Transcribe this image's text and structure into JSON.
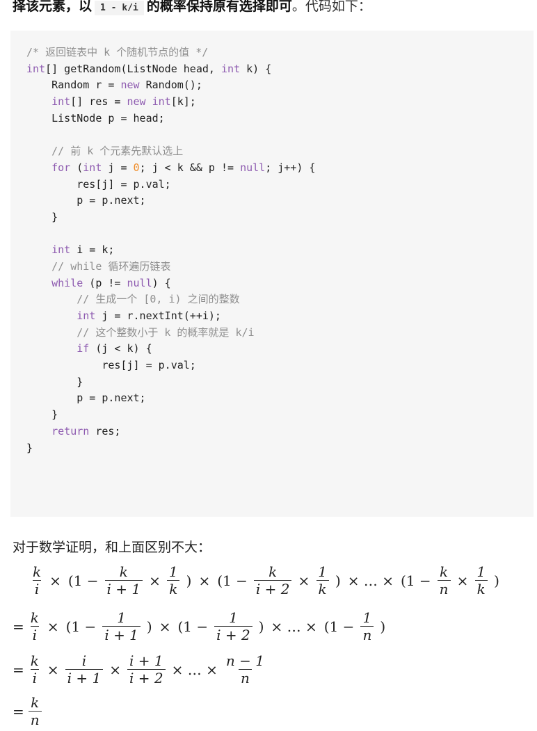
{
  "intro_line": {
    "bold_prefix": "择该元素，以",
    "inline_code": "1 - k/i",
    "bold_suffix": "的概率保持原有选择即可",
    "tail": "。代码如下："
  },
  "code": {
    "language": "java",
    "lines": [
      [
        {
          "t": "/* 返回链表中 k 个随机节点的值 */",
          "c": "cm"
        }
      ],
      [
        {
          "t": "int",
          "c": "kw"
        },
        {
          "t": "[] getRandom(ListNode head, "
        },
        {
          "t": "int",
          "c": "kw"
        },
        {
          "t": " k) {"
        }
      ],
      [
        {
          "t": "    Random r = "
        },
        {
          "t": "new",
          "c": "kw"
        },
        {
          "t": " Random();"
        }
      ],
      [
        {
          "t": "    "
        },
        {
          "t": "int",
          "c": "kw"
        },
        {
          "t": "[] res = "
        },
        {
          "t": "new",
          "c": "kw"
        },
        {
          "t": " "
        },
        {
          "t": "int",
          "c": "kw"
        },
        {
          "t": "[k];"
        }
      ],
      [
        {
          "t": "    ListNode p = head;"
        }
      ],
      [
        {
          "t": ""
        }
      ],
      [
        {
          "t": "    "
        },
        {
          "t": "// 前 k 个元素先默认选上",
          "c": "cm"
        }
      ],
      [
        {
          "t": "    "
        },
        {
          "t": "for",
          "c": "kw"
        },
        {
          "t": " ("
        },
        {
          "t": "int",
          "c": "kw"
        },
        {
          "t": " j = "
        },
        {
          "t": "0",
          "c": "num"
        },
        {
          "t": "; j < k && p != "
        },
        {
          "t": "null",
          "c": "kw"
        },
        {
          "t": "; j++) {"
        }
      ],
      [
        {
          "t": "        res[j] = p.val;"
        }
      ],
      [
        {
          "t": "        p = p.next;"
        }
      ],
      [
        {
          "t": "    }"
        }
      ],
      [
        {
          "t": ""
        }
      ],
      [
        {
          "t": "    "
        },
        {
          "t": "int",
          "c": "kw"
        },
        {
          "t": " i = k;"
        }
      ],
      [
        {
          "t": "    "
        },
        {
          "t": "// while 循环遍历链表",
          "c": "cm"
        }
      ],
      [
        {
          "t": "    "
        },
        {
          "t": "while",
          "c": "kw"
        },
        {
          "t": " (p != "
        },
        {
          "t": "null",
          "c": "kw"
        },
        {
          "t": ") {"
        }
      ],
      [
        {
          "t": "        "
        },
        {
          "t": "// 生成一个 [0, i) 之间的整数",
          "c": "cm"
        }
      ],
      [
        {
          "t": "        "
        },
        {
          "t": "int",
          "c": "kw"
        },
        {
          "t": " j = r.nextInt(++i);"
        }
      ],
      [
        {
          "t": "        "
        },
        {
          "t": "// 这个整数小于 k 的概率就是 k/i",
          "c": "cm"
        }
      ],
      [
        {
          "t": "        "
        },
        {
          "t": "if",
          "c": "kw"
        },
        {
          "t": " (j < k) {"
        }
      ],
      [
        {
          "t": "            res[j] = p.val;"
        }
      ],
      [
        {
          "t": "        }"
        }
      ],
      [
        {
          "t": "        p = p.next;"
        }
      ],
      [
        {
          "t": "    }"
        }
      ],
      [
        {
          "t": "    "
        },
        {
          "t": "return",
          "c": "kw"
        },
        {
          "t": " res;"
        }
      ],
      [
        {
          "t": "}"
        }
      ]
    ]
  },
  "proof_intro": "对于数学证明，和上面区别不大：",
  "math": {
    "rows": [
      [
        {
          "frac": [
            "k",
            "i"
          ]
        },
        {
          "sym": "×"
        },
        {
          "sym": "(1 −"
        },
        {
          "frac": [
            "k",
            "i + 1"
          ]
        },
        {
          "sym": "×"
        },
        {
          "frac": [
            "1",
            "k"
          ]
        },
        {
          "sym": ")"
        },
        {
          "sym": "×"
        },
        {
          "sym": "(1 −"
        },
        {
          "frac": [
            "k",
            "i + 2"
          ]
        },
        {
          "sym": "×"
        },
        {
          "frac": [
            "1",
            "k"
          ]
        },
        {
          "sym": ")"
        },
        {
          "sym": "× … ×"
        },
        {
          "sym": "(1 −"
        },
        {
          "frac": [
            "k",
            "n"
          ]
        },
        {
          "sym": "×"
        },
        {
          "frac": [
            "1",
            "k"
          ]
        },
        {
          "sym": ")"
        }
      ],
      [
        {
          "eq": "="
        },
        {
          "frac": [
            "k",
            "i"
          ]
        },
        {
          "sym": "×"
        },
        {
          "sym": "(1 −"
        },
        {
          "frac": [
            "1",
            "i + 1"
          ]
        },
        {
          "sym": ")"
        },
        {
          "sym": "×"
        },
        {
          "sym": "(1 −"
        },
        {
          "frac": [
            "1",
            "i + 2"
          ]
        },
        {
          "sym": ")"
        },
        {
          "sym": "× … ×"
        },
        {
          "sym": "(1 −"
        },
        {
          "frac": [
            "1",
            "n"
          ]
        },
        {
          "sym": ")"
        }
      ],
      [
        {
          "eq": "="
        },
        {
          "frac": [
            "k",
            "i"
          ]
        },
        {
          "sym": "×"
        },
        {
          "frac": [
            "i",
            "i + 1"
          ]
        },
        {
          "sym": "×"
        },
        {
          "frac": [
            "i + 1",
            "i + 2"
          ]
        },
        {
          "sym": "× … ×"
        },
        {
          "frac": [
            "n − 1",
            "n"
          ]
        }
      ],
      [
        {
          "eq": "="
        },
        {
          "frac": [
            "k",
            "n"
          ]
        }
      ]
    ]
  }
}
